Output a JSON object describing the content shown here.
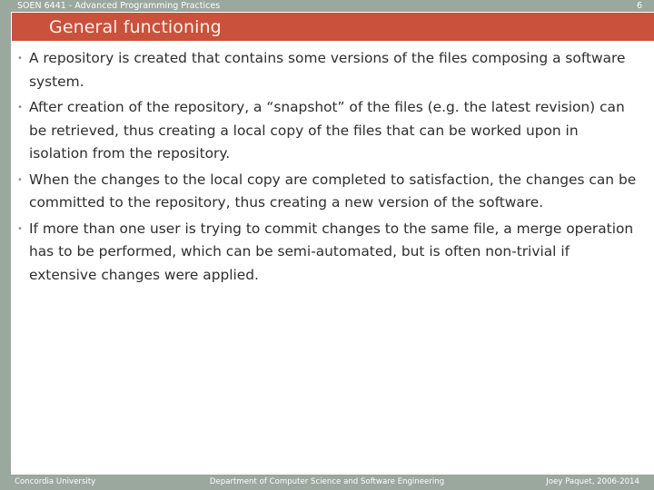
{
  "header": {
    "course": "SOEN 6441 - Advanced Programming Practices",
    "page_number": "6",
    "bar_color": "#9aa89e"
  },
  "title": {
    "text": "General functioning",
    "band_color": "#ca513c",
    "text_color": "#f7f2ea"
  },
  "body": {
    "bullet_glyph": "•",
    "bullets": [
      {
        "text": "A repository is created that contains some versions of the files composing a software system."
      },
      {
        "text": "After creation of the repository, a “snapshot” of the files (e.g. the latest revision) can be retrieved, thus creating a local copy of the files that can be worked upon in isolation from the repository."
      },
      {
        "text": "When the changes to the local copy are completed to satisfaction, the changes can be committed to the repository, thus creating a new version of the software."
      },
      {
        "text": "If more than one user is trying to commit changes to the same file, a merge operation has to be performed, which can be semi-automated, but is often non-trivial if extensive changes were applied."
      }
    ]
  },
  "footer": {
    "left": "Concordia University",
    "center": "Department of Computer Science and Software Engineering",
    "right": "Joey Paquet, 2006-2014",
    "bar_color": "#9aa89e"
  }
}
